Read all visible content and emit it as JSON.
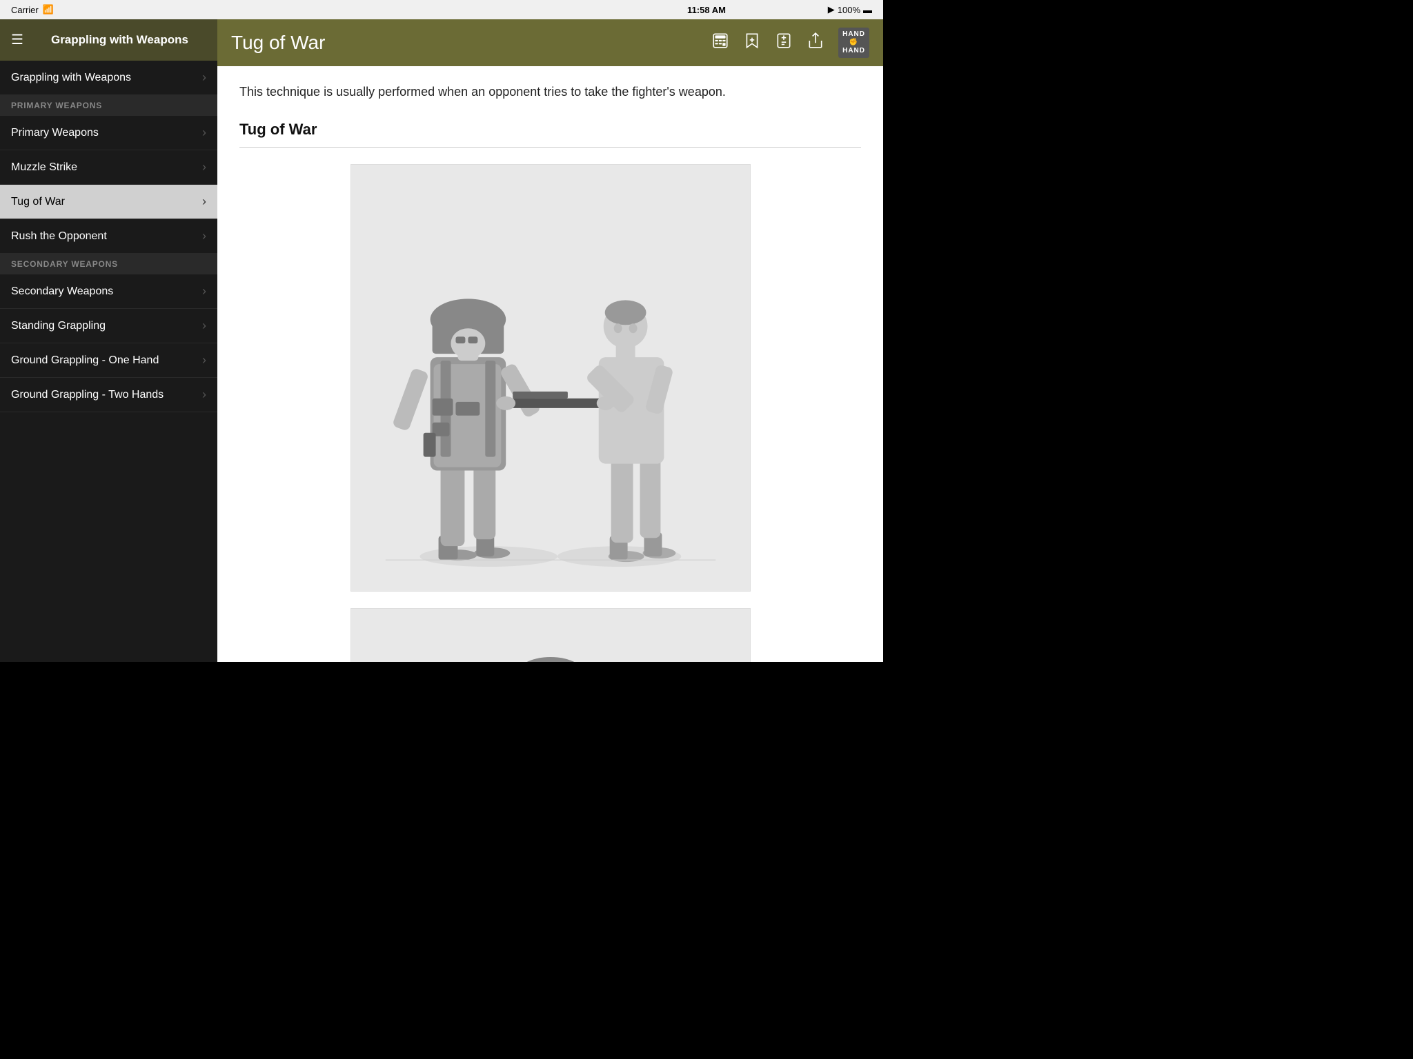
{
  "status_bar": {
    "carrier": "Carrier",
    "wifi_icon": "wifi",
    "time": "11:58 AM",
    "signal_icon": "signal",
    "battery": "100%",
    "battery_icon": "battery"
  },
  "sidebar": {
    "header": {
      "title": "Grappling with Weapons",
      "hamburger_icon": "menu"
    },
    "top_nav": [
      {
        "id": "grappling-with-weapons",
        "label": "Grappling with Weapons",
        "has_chevron": true
      }
    ],
    "sections": [
      {
        "id": "primary-weapons-section",
        "header": "PRIMARY WEAPONS",
        "items": [
          {
            "id": "primary-weapons",
            "label": "Primary Weapons",
            "has_chevron": true,
            "active": false
          },
          {
            "id": "muzzle-strike",
            "label": "Muzzle Strike",
            "has_chevron": true,
            "active": false
          },
          {
            "id": "tug-of-war",
            "label": "Tug of War",
            "has_chevron": true,
            "active": true
          },
          {
            "id": "rush-the-opponent",
            "label": "Rush the Opponent",
            "has_chevron": true,
            "active": false
          }
        ]
      },
      {
        "id": "secondary-weapons-section",
        "header": "SECONDARY WEAPONS",
        "items": [
          {
            "id": "secondary-weapons",
            "label": "Secondary Weapons",
            "has_chevron": true,
            "active": false
          },
          {
            "id": "standing-grappling",
            "label": "Standing Grappling",
            "has_chevron": true,
            "active": false
          },
          {
            "id": "ground-grappling-one-hand",
            "label": "Ground Grappling - One Hand",
            "has_chevron": true,
            "active": false
          },
          {
            "id": "ground-grappling-two-hands",
            "label": "Ground Grappling - Two Hands",
            "has_chevron": true,
            "active": false
          }
        ]
      }
    ]
  },
  "content": {
    "header_title": "Tug of War",
    "logo_line1": "HAND",
    "logo_line2": "✊",
    "logo_line3": "HAND",
    "intro_text": "This technique is usually performed when an opponent tries to take the fighter's weapon.",
    "section_title": "Tug of War",
    "toolbar": {
      "calculator_icon": "calculator",
      "bookmark_icon": "bookmark-add",
      "note_icon": "note-add",
      "share_icon": "share"
    }
  }
}
